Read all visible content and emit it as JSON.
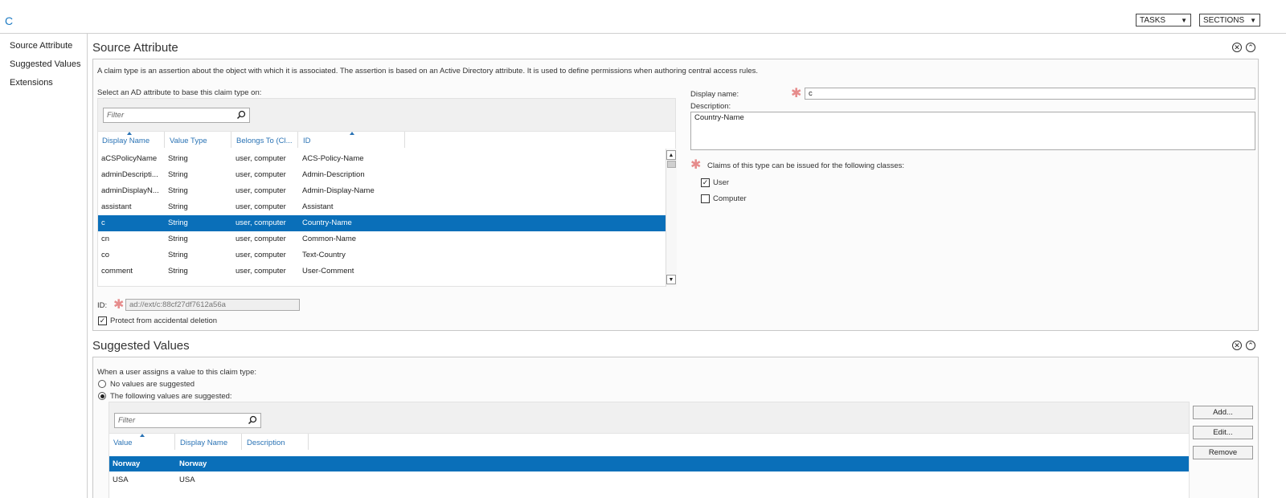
{
  "window": {
    "title": "C"
  },
  "top_buttons": {
    "tasks": "TASKS",
    "sections": "SECTIONS"
  },
  "nav": {
    "items": [
      "Source Attribute",
      "Suggested Values",
      "Extensions"
    ]
  },
  "source_attribute": {
    "title": "Source Attribute",
    "intro": "A claim type is an assertion about the object with which it is associated. The assertion is based on an Active Directory attribute. It is used to define permissions when authoring central access rules.",
    "select_label": "Select an AD attribute to base this claim type on:",
    "filter_placeholder": "Filter",
    "columns": [
      "Display Name",
      "Value Type",
      "Belongs To (Cl...",
      "ID"
    ],
    "rows": [
      {
        "name": "aCSPolicyName",
        "type": "String",
        "belongs": "user, computer",
        "id": "ACS-Policy-Name"
      },
      {
        "name": "adminDescripti...",
        "type": "String",
        "belongs": "user, computer",
        "id": "Admin-Description"
      },
      {
        "name": "adminDisplayN...",
        "type": "String",
        "belongs": "user, computer",
        "id": "Admin-Display-Name"
      },
      {
        "name": "assistant",
        "type": "String",
        "belongs": "user, computer",
        "id": "Assistant"
      },
      {
        "name": "c",
        "type": "String",
        "belongs": "user, computer",
        "id": "Country-Name"
      },
      {
        "name": "cn",
        "type": "String",
        "belongs": "user, computer",
        "id": "Common-Name"
      },
      {
        "name": "co",
        "type": "String",
        "belongs": "user, computer",
        "id": "Text-Country"
      },
      {
        "name": "comment",
        "type": "String",
        "belongs": "user, computer",
        "id": "User-Comment"
      }
    ],
    "selected_row": 4,
    "id_label": "ID:",
    "id_value": "ad://ext/c:88cf27df7612a56a",
    "protect_label": "Protect from accidental deletion",
    "protect_checked": true,
    "display_name_label": "Display name:",
    "display_name_value": "c",
    "description_label": "Description:",
    "description_value": "Country-Name",
    "classes_label": "Claims of this type can be issued for the following classes:",
    "classes": [
      {
        "label": "User",
        "checked": true
      },
      {
        "label": "Computer",
        "checked": false
      }
    ]
  },
  "suggested_values": {
    "title": "Suggested Values",
    "intro": "When a user assigns a value to this claim type:",
    "option_none": "No values are suggested",
    "option_following": "The following values are suggested:",
    "selected_option": "following",
    "filter_placeholder": "Filter",
    "columns": [
      "Value",
      "Display Name",
      "Description"
    ],
    "rows": [
      {
        "value": "Norway",
        "display": "Norway",
        "description": ""
      },
      {
        "value": "USA",
        "display": "USA",
        "description": ""
      }
    ],
    "selected_row": 0,
    "buttons": {
      "add": "Add...",
      "edit": "Edit...",
      "remove": "Remove"
    }
  },
  "colors": {
    "accent": "#0a6fb9",
    "link": "#2a73b5",
    "required": "#e68c8c"
  }
}
